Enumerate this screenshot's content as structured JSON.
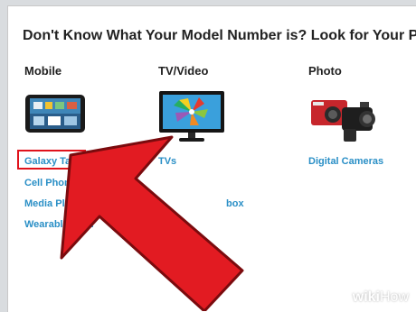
{
  "heading": "Don't Know What Your Model Number is? Look for Your Produc",
  "categories": [
    {
      "title": "Mobile",
      "links": [
        "Galaxy Tab",
        "Cell Phones",
        "Media Players",
        "Wearable Tech"
      ]
    },
    {
      "title": "TV/Video",
      "links": [
        "TVs",
        "box"
      ]
    },
    {
      "title": "Photo",
      "links": [
        "Digital Cameras"
      ]
    }
  ],
  "watermark": {
    "wiki": "wiki",
    "how": "How"
  },
  "colors": {
    "link": "#2a8fc6",
    "highlight": "#e0121b",
    "arrow": "#e21b22"
  }
}
